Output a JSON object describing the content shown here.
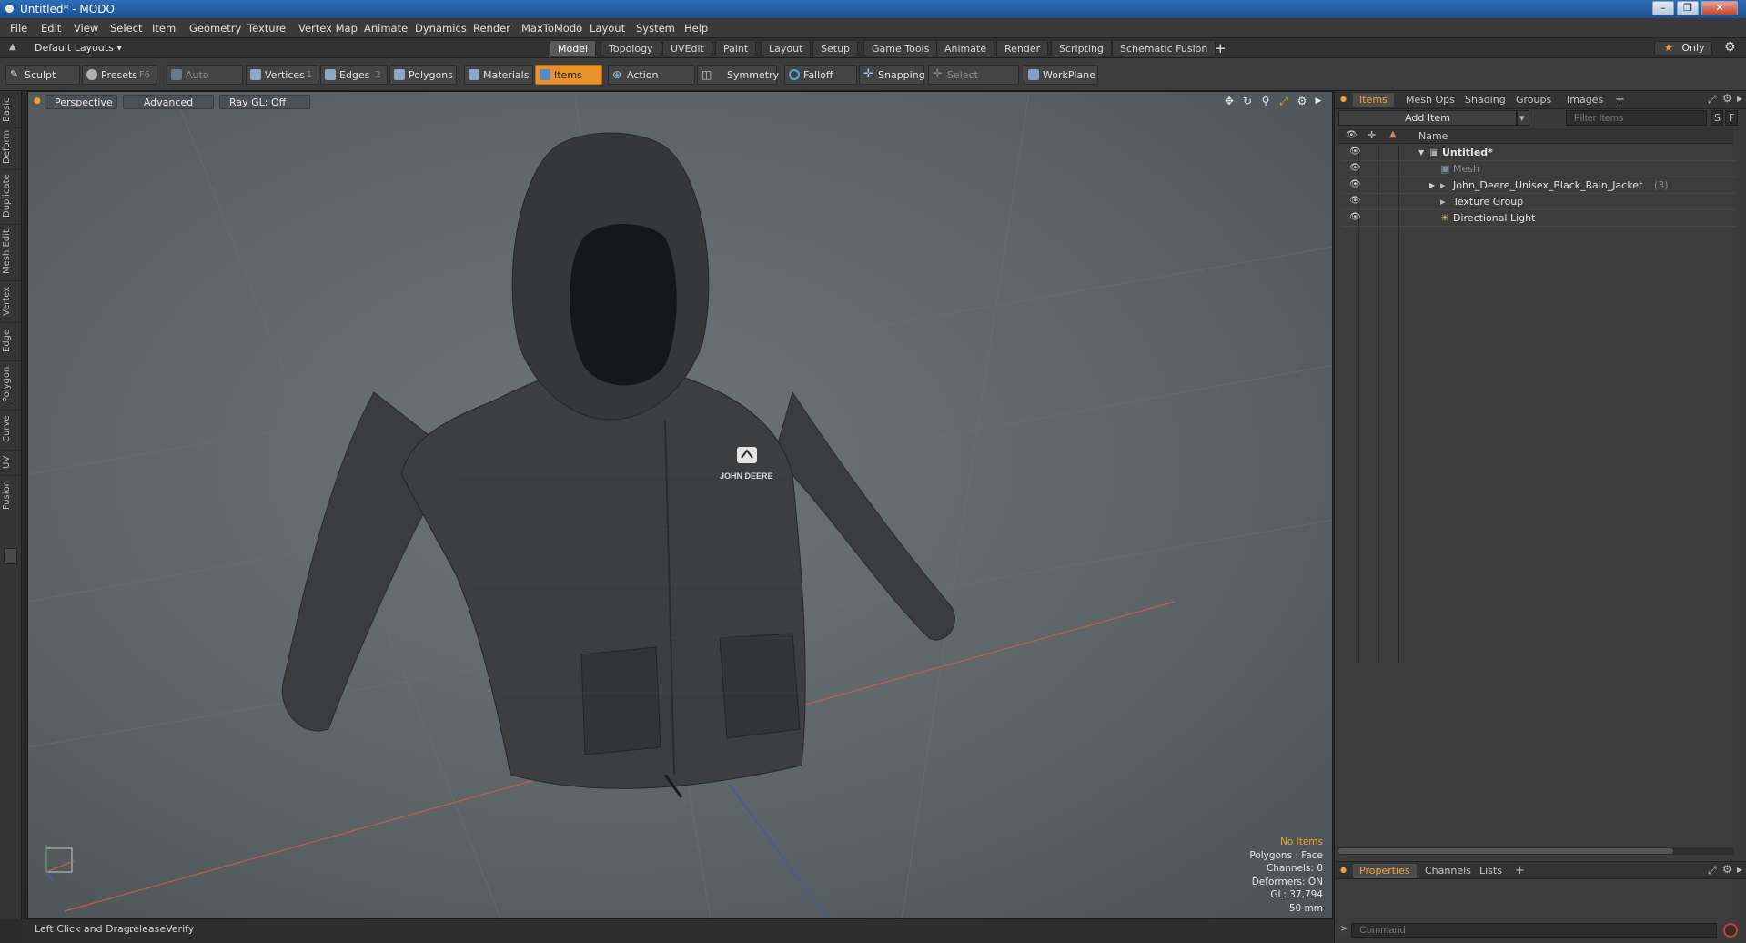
{
  "window": {
    "title": "Untitled* - MODO"
  },
  "menu": [
    "File",
    "Edit",
    "View",
    "Select",
    "Item",
    "Geometry",
    "Texture",
    "Vertex Map",
    "Animate",
    "Dynamics",
    "Render",
    "MaxToModo",
    "Layout",
    "System",
    "Help"
  ],
  "layoutbar": {
    "layout_dropdown": "Default Layouts",
    "tabs": [
      "Model",
      "Topology",
      "UVEdit",
      "Paint",
      "Layout",
      "Setup",
      "Game Tools",
      "Animate",
      "Render",
      "Scripting",
      "Schematic Fusion"
    ],
    "active_tab": "Model",
    "add_label": "+",
    "only_label": "Only"
  },
  "toolbar": {
    "sculpt": "Sculpt",
    "presets": "Presets",
    "presets_key": "F6",
    "auto_select": "Auto Select",
    "vertices": "Vertices",
    "vertices_key": "1",
    "edges": "Edges",
    "edges_key": "2",
    "polygons": "Polygons",
    "materials": "Materials",
    "items": "Items",
    "action_center": "Action Center",
    "symmetry": "Symmetry",
    "falloff": "Falloff",
    "snapping": "Snapping",
    "select_through": "Select Through",
    "workplane": "WorkPlane"
  },
  "left_tabs": [
    "Basic",
    "Deform",
    "Duplicate",
    "Mesh Edit",
    "Vertex",
    "Edge",
    "Polygon",
    "Curve",
    "UV",
    "Fusion"
  ],
  "viewport": {
    "view_mode": "Perspective",
    "advanced": "Advanced",
    "raygl": "Ray GL: Off",
    "logo_text": "JOHN DEERE",
    "info": {
      "selection": "No Items",
      "polygons": "Polygons : Face",
      "channels": "Channels: 0",
      "deformers": "Deformers: ON",
      "gl": "GL: 37,794",
      "units": "50 mm"
    }
  },
  "statusbar": {
    "hint_label": "Left Click and Drag:",
    "hint_value": "releaseVerify"
  },
  "items_panel": {
    "tabs": [
      "Items",
      "Mesh Ops",
      "Shading",
      "Groups",
      "Images"
    ],
    "active_tab": "Items",
    "add_item": "Add Item",
    "filter_placeholder": "Filter Items",
    "s_button": "S",
    "f_button": "F",
    "column_name": "Name",
    "tree": [
      {
        "label": "Untitled*",
        "level": 0
      },
      {
        "label": "Mesh",
        "level": 1,
        "dim": true
      },
      {
        "label": "John_Deere_Unisex_Black_Rain_Jacket",
        "count": "(3)",
        "level": 1
      },
      {
        "label": "Texture Group",
        "level": 1
      },
      {
        "label": "Directional Light",
        "level": 1
      }
    ]
  },
  "properties_panel": {
    "tabs": [
      "Properties",
      "Channels",
      "Lists"
    ],
    "active_tab": "Properties",
    "command_placeholder": "Command"
  },
  "colors": {
    "accent": "#e8922a",
    "title_blue": "#2b6fb8",
    "viewport_bg": "#5f676b"
  }
}
